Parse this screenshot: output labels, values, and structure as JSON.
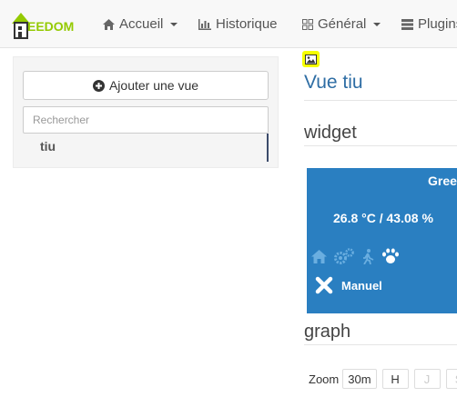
{
  "navbar": {
    "logo_text": "EEDOM",
    "items": [
      {
        "label": "Accueil",
        "icon": "home-icon",
        "dropdown": true
      },
      {
        "label": "Historique",
        "icon": "bar-chart-icon",
        "dropdown": false
      },
      {
        "label": "Général",
        "icon": "grid-icon",
        "dropdown": true
      },
      {
        "label": "Plugins",
        "icon": "list-icon",
        "dropdown": true
      }
    ]
  },
  "sidebar": {
    "add_button_label": "Ajouter une vue",
    "search_placeholder": "Rechercher",
    "views": [
      "tiu"
    ]
  },
  "main": {
    "view_title": "Vue tiu",
    "sections": {
      "widget": "widget",
      "graph": "graph"
    },
    "widget_card": {
      "name": "Gree",
      "value": "26.8 °C / 43.08 %",
      "mode_label": "Manuel",
      "mode_icons": [
        "home-icon",
        "cogs-icon",
        "walking-person-icon",
        "paw-icon"
      ]
    },
    "zoom": {
      "label": "Zoom",
      "buttons": [
        {
          "label": "30m",
          "enabled": true
        },
        {
          "label": "H",
          "enabled": true
        },
        {
          "label": "J",
          "enabled": false
        },
        {
          "label": "S",
          "enabled": false
        }
      ]
    }
  },
  "colors": {
    "brand_green": "#94ca02",
    "widget_bg": "#2a7fc1",
    "title_blue": "#2e6da4",
    "highlight": "#f6ff00"
  }
}
